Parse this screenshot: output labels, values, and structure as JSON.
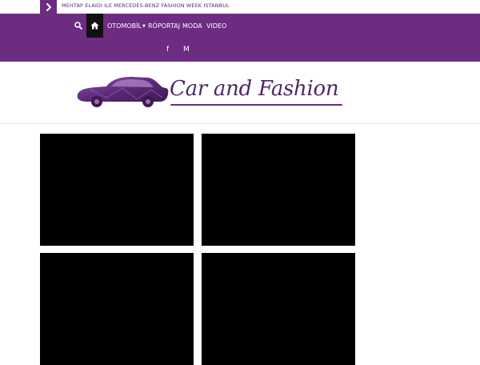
{
  "ticker": {
    "headline": "MEHTAP ELAIDI ILE MERCEDES-BENZ FASHION WEEK ISTANBUL"
  },
  "nav": {
    "items": [
      {
        "label": "OTOMOBİL",
        "has_dropdown": true
      },
      {
        "label": "RÖPORTAJ",
        "has_dropdown": false
      },
      {
        "label": "MODA",
        "has_dropdown": false
      },
      {
        "label": "VIDEO",
        "has_dropdown": false
      }
    ],
    "social": {
      "facebook": "f",
      "medium": "M"
    }
  },
  "logo": {
    "text": "Car and Fashion"
  },
  "colors": {
    "brand_purple": "#6b2c82",
    "dark": "#111111",
    "video_bg": "#000000"
  },
  "videos": [
    {
      "state": "black"
    },
    {
      "state": "black"
    },
    {
      "state": "black"
    },
    {
      "state": "black"
    }
  ]
}
